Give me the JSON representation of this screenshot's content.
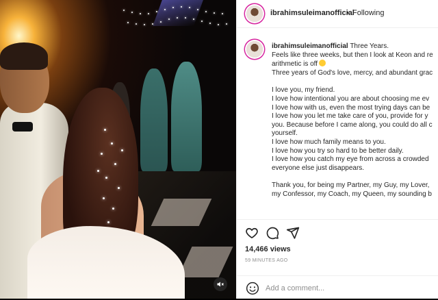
{
  "post": {
    "username": "ibrahimsuleimanofficial",
    "separator": "•",
    "follow_status": "Following"
  },
  "caption": {
    "username": "ibrahimsuleimanofficial",
    "lines": [
      "Three Years.",
      "Feels like three weeks, but then I look at Keon and re",
      "arithmetic is off",
      "Three years of God's love, mercy, and abundant grac",
      "",
      "I love you, my friend.",
      "I love how intentional you are about choosing me ev",
      "I love how with us, even the most trying days can be",
      "I love how you let me take care of you, provide for y",
      "you. Because before I came along, you could do all c",
      "yourself.",
      "I love how much family means to you.",
      "I love how you try so hard to be better daily.",
      "I love how you catch my eye from across a crowded",
      "everyone else just disappears.",
      "",
      "Thank you, for being my Partner, my Guy, my Lover,",
      "my Confessor, my Coach, my Queen, my sounding b"
    ]
  },
  "icons": {
    "like": "heart-icon",
    "comment": "comment-icon",
    "share": "share-icon",
    "mute": "mute-icon",
    "emoji": "emoji-icon"
  },
  "stats": {
    "views": "14,466 views",
    "time_ago": "59 MINUTES AGO"
  },
  "comment_box": {
    "placeholder": "Add a comment..."
  }
}
